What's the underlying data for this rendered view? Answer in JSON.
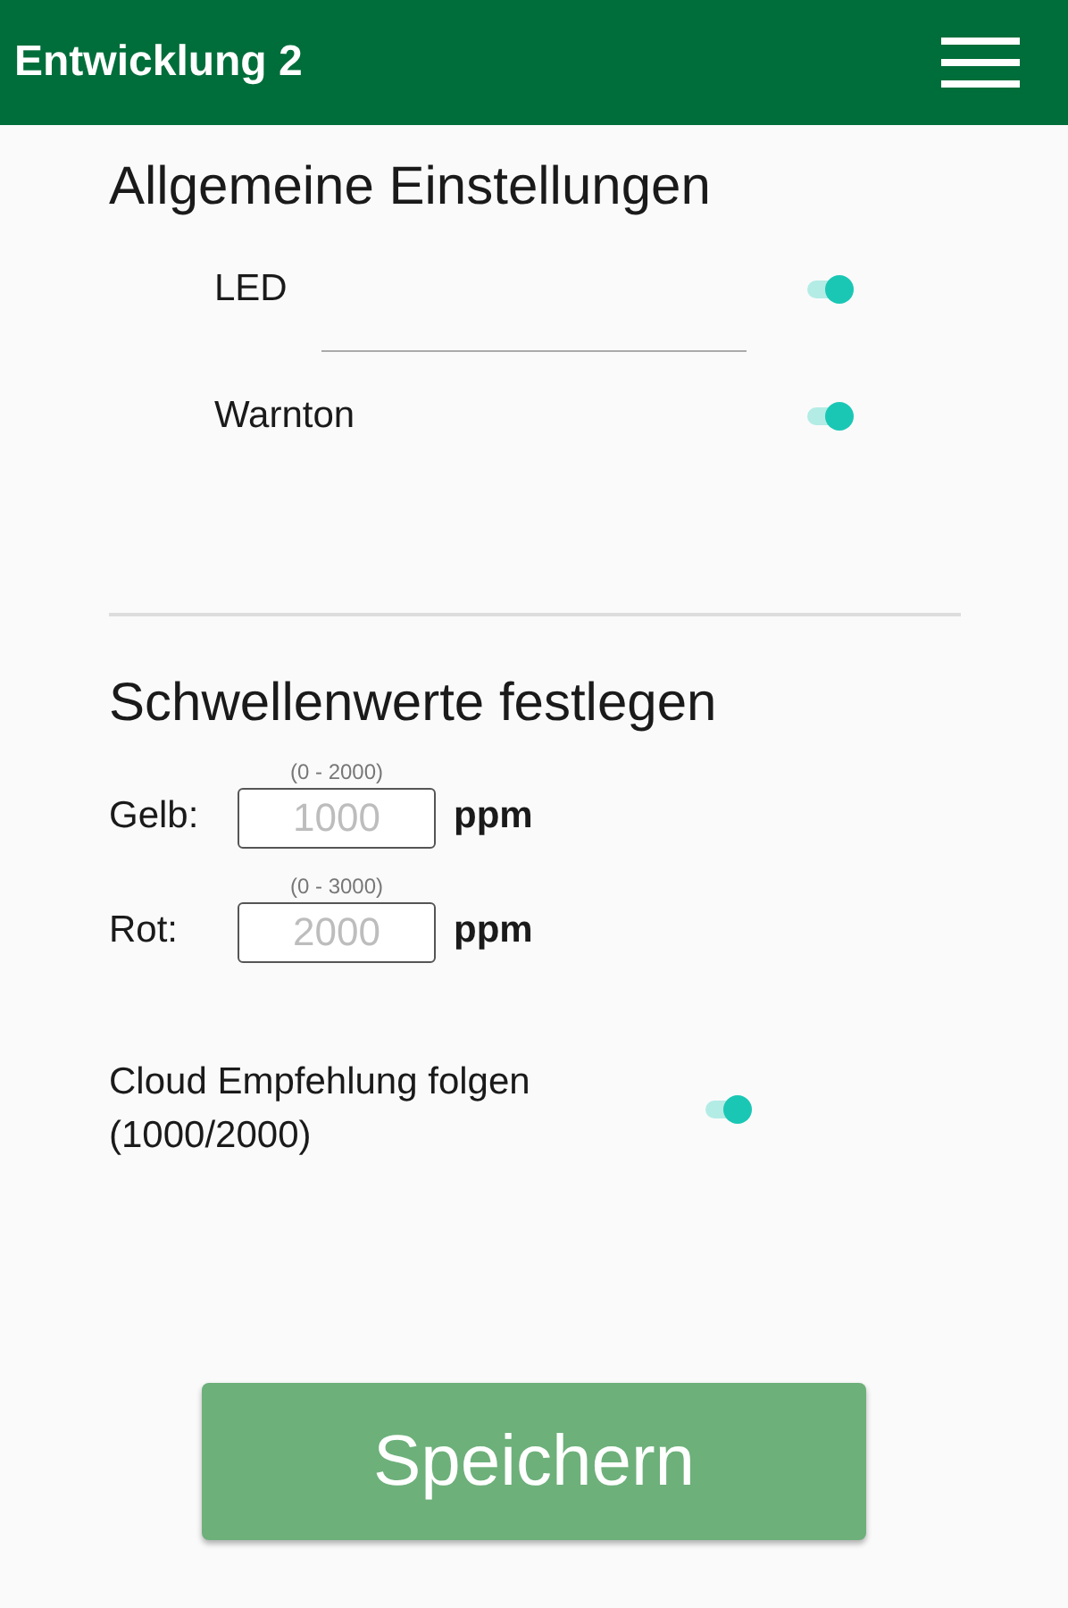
{
  "app_bar": {
    "title": "Entwicklung 2"
  },
  "general_settings": {
    "heading": "Allgemeine Einstellungen",
    "toggles": [
      {
        "label": "LED",
        "on": true
      },
      {
        "label": "Warnton",
        "on": true
      }
    ]
  },
  "thresholds": {
    "heading": "Schwellenwerte festlegen",
    "fields": [
      {
        "label": "Gelb:",
        "range": "(0 - 2000)",
        "placeholder": "1000",
        "unit": "ppm"
      },
      {
        "label": "Rot:",
        "range": "(0 - 3000)",
        "placeholder": "2000",
        "unit": "ppm"
      }
    ],
    "cloud": {
      "label_line1": "Cloud Empfehlung folgen",
      "label_line2": "(1000/2000)",
      "on": true
    }
  },
  "save_button": "Speichern"
}
